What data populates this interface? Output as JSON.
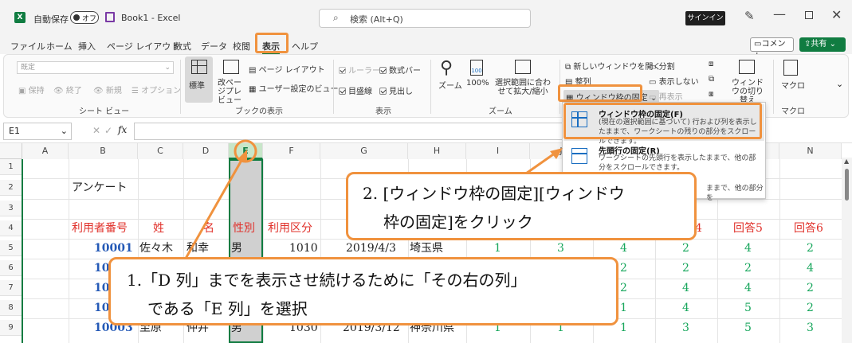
{
  "title": {
    "autosave": "自動保存",
    "toggle": "オフ",
    "book": "Book1 - Excel",
    "search": "検索 (Alt+Q)",
    "signin": "サインイン"
  },
  "tabs": [
    "ファイル",
    "ホーム",
    "挿入",
    "ページ レイアウト",
    "数式",
    "データ",
    "校閲",
    "表示",
    "ヘルプ"
  ],
  "comment": "コメント",
  "share": "共有",
  "ribbon": {
    "sheetview": {
      "select": "既定",
      "keep": "保持",
      "exit": "終了",
      "new": "新規",
      "options": "オプション",
      "label": "シート ビュー"
    },
    "bookview": {
      "normal": "標準",
      "pagebreak": "改ページプレビュー",
      "pagelayout": "ページ レイアウト",
      "custom": "ユーザー設定のビュー",
      "label": "ブックの表示"
    },
    "show": {
      "ruler": "ルーラー",
      "formulabar": "数式バー",
      "gridlines": "目盛線",
      "headings": "見出し",
      "label": "表示"
    },
    "zoom": {
      "zoom": "ズーム",
      "pct": "100%",
      "fit": "選択範囲に合わせて拡大/縮小",
      "label": "ズーム"
    },
    "window": {
      "newwin": "新しいウィンドウを開く",
      "arrange": "整列",
      "freeze": "ウィンドウ枠の固定",
      "split": "分割",
      "hide": "表示しない",
      "unhide": "再表示",
      "switch": "ウィンドウの切り替え"
    },
    "macro": {
      "macro": "マクロ",
      "label": "マクロ"
    }
  },
  "formula": {
    "namebox": "E1",
    "fx": "fx"
  },
  "menu": [
    {
      "title": "ウィンドウ枠の固定(F)",
      "desc": "(現在の選択範囲に基づいて) 行および列を表示したままで、ワークシートの残りの部分をスクロールできます。"
    },
    {
      "title": "先頭行の固定(R)",
      "desc": "ワークシートの先頭行を表示したままで、他の部分をスクロールできます。"
    },
    {
      "title": "",
      "desc": "ままで、他の部分を"
    }
  ],
  "columns": [
    "A",
    "B",
    "C",
    "D",
    "E",
    "F",
    "G",
    "H",
    "I",
    "J",
    "K",
    "L",
    "M",
    "N"
  ],
  "rows": [
    "1",
    "2",
    "3",
    "4",
    "5",
    "6",
    "7",
    "8",
    "9"
  ],
  "cells": {
    "b2": "アンケート",
    "b4": "利用者番号",
    "c4": "姓",
    "d4": "名",
    "e4": "性別",
    "f4": "利用区分",
    "m4": "回答5",
    "n4": "回答6",
    "l4": "4",
    "b5": "10001",
    "c5": "佐々木",
    "d5": "和幸",
    "e5": "男",
    "f5": "1010",
    "g5": "2019/4/3",
    "h5": "埼玉県",
    "i5": "1",
    "j5": "3",
    "k5": "4",
    "l5": "2",
    "m5": "4",
    "n5": "2",
    "b6": "10",
    "k6": "2",
    "l6": "2",
    "m6": "2",
    "n6": "4",
    "b7": "10",
    "k7": "2",
    "l7": "4",
    "m7": "4",
    "n7": "2",
    "b8": "10",
    "k8": "1",
    "l8": "4",
    "m8": "5",
    "n8": "2",
    "b9": "10003",
    "c9": "至原",
    "d9": "仲井",
    "e9": "男",
    "f9": "1030",
    "g9": "2019/3/12",
    "h9": "神奈川県",
    "i9": "1",
    "j9": "1",
    "k9": "1",
    "l9": "3",
    "m9": "5",
    "n9": "3"
  },
  "callouts": {
    "c1a": "1.「D 列」までを表示させ続けるために「その右の列」",
    "c1b": "である「E 列」を選択",
    "c2a": "2. [ウィンドウ枠の固定][ウィンドウ",
    "c2b": "枠の固定]をクリック"
  },
  "colors": {
    "accent": "#f0923e",
    "excel_green": "#107c41",
    "link_blue": "#2459b6",
    "red": "#e0302a",
    "green": "#17a65c"
  }
}
